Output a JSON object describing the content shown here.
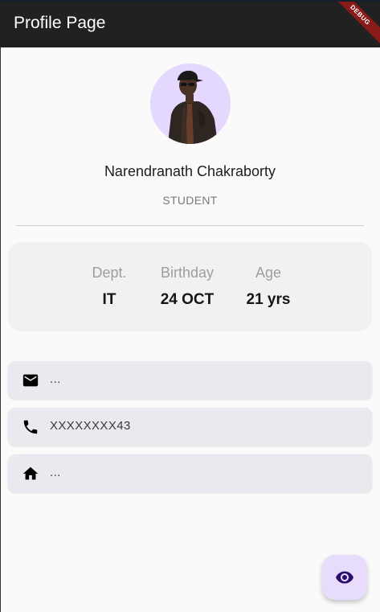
{
  "appbar": {
    "title": "Profile Page",
    "debug_banner": "DEBUG"
  },
  "profile": {
    "name": "Narendranath Chakraborty",
    "role": "STUDENT"
  },
  "stats": [
    {
      "label": "Dept.",
      "value": "IT"
    },
    {
      "label": "Birthday",
      "value": "24 OCT"
    },
    {
      "label": "Age",
      "value": "21 yrs"
    }
  ],
  "contact": {
    "email": "...",
    "phone": "XXXXXXXX43",
    "address": "..."
  },
  "icons": {
    "email": "email-icon",
    "phone": "phone-icon",
    "home": "home-icon",
    "fab": "eye-icon"
  },
  "colors": {
    "appbar": "#212121",
    "avatar_bg": "#e4d8ff",
    "fab_bg": "#e7dcfb",
    "fab_icon": "#2b0f6e"
  }
}
